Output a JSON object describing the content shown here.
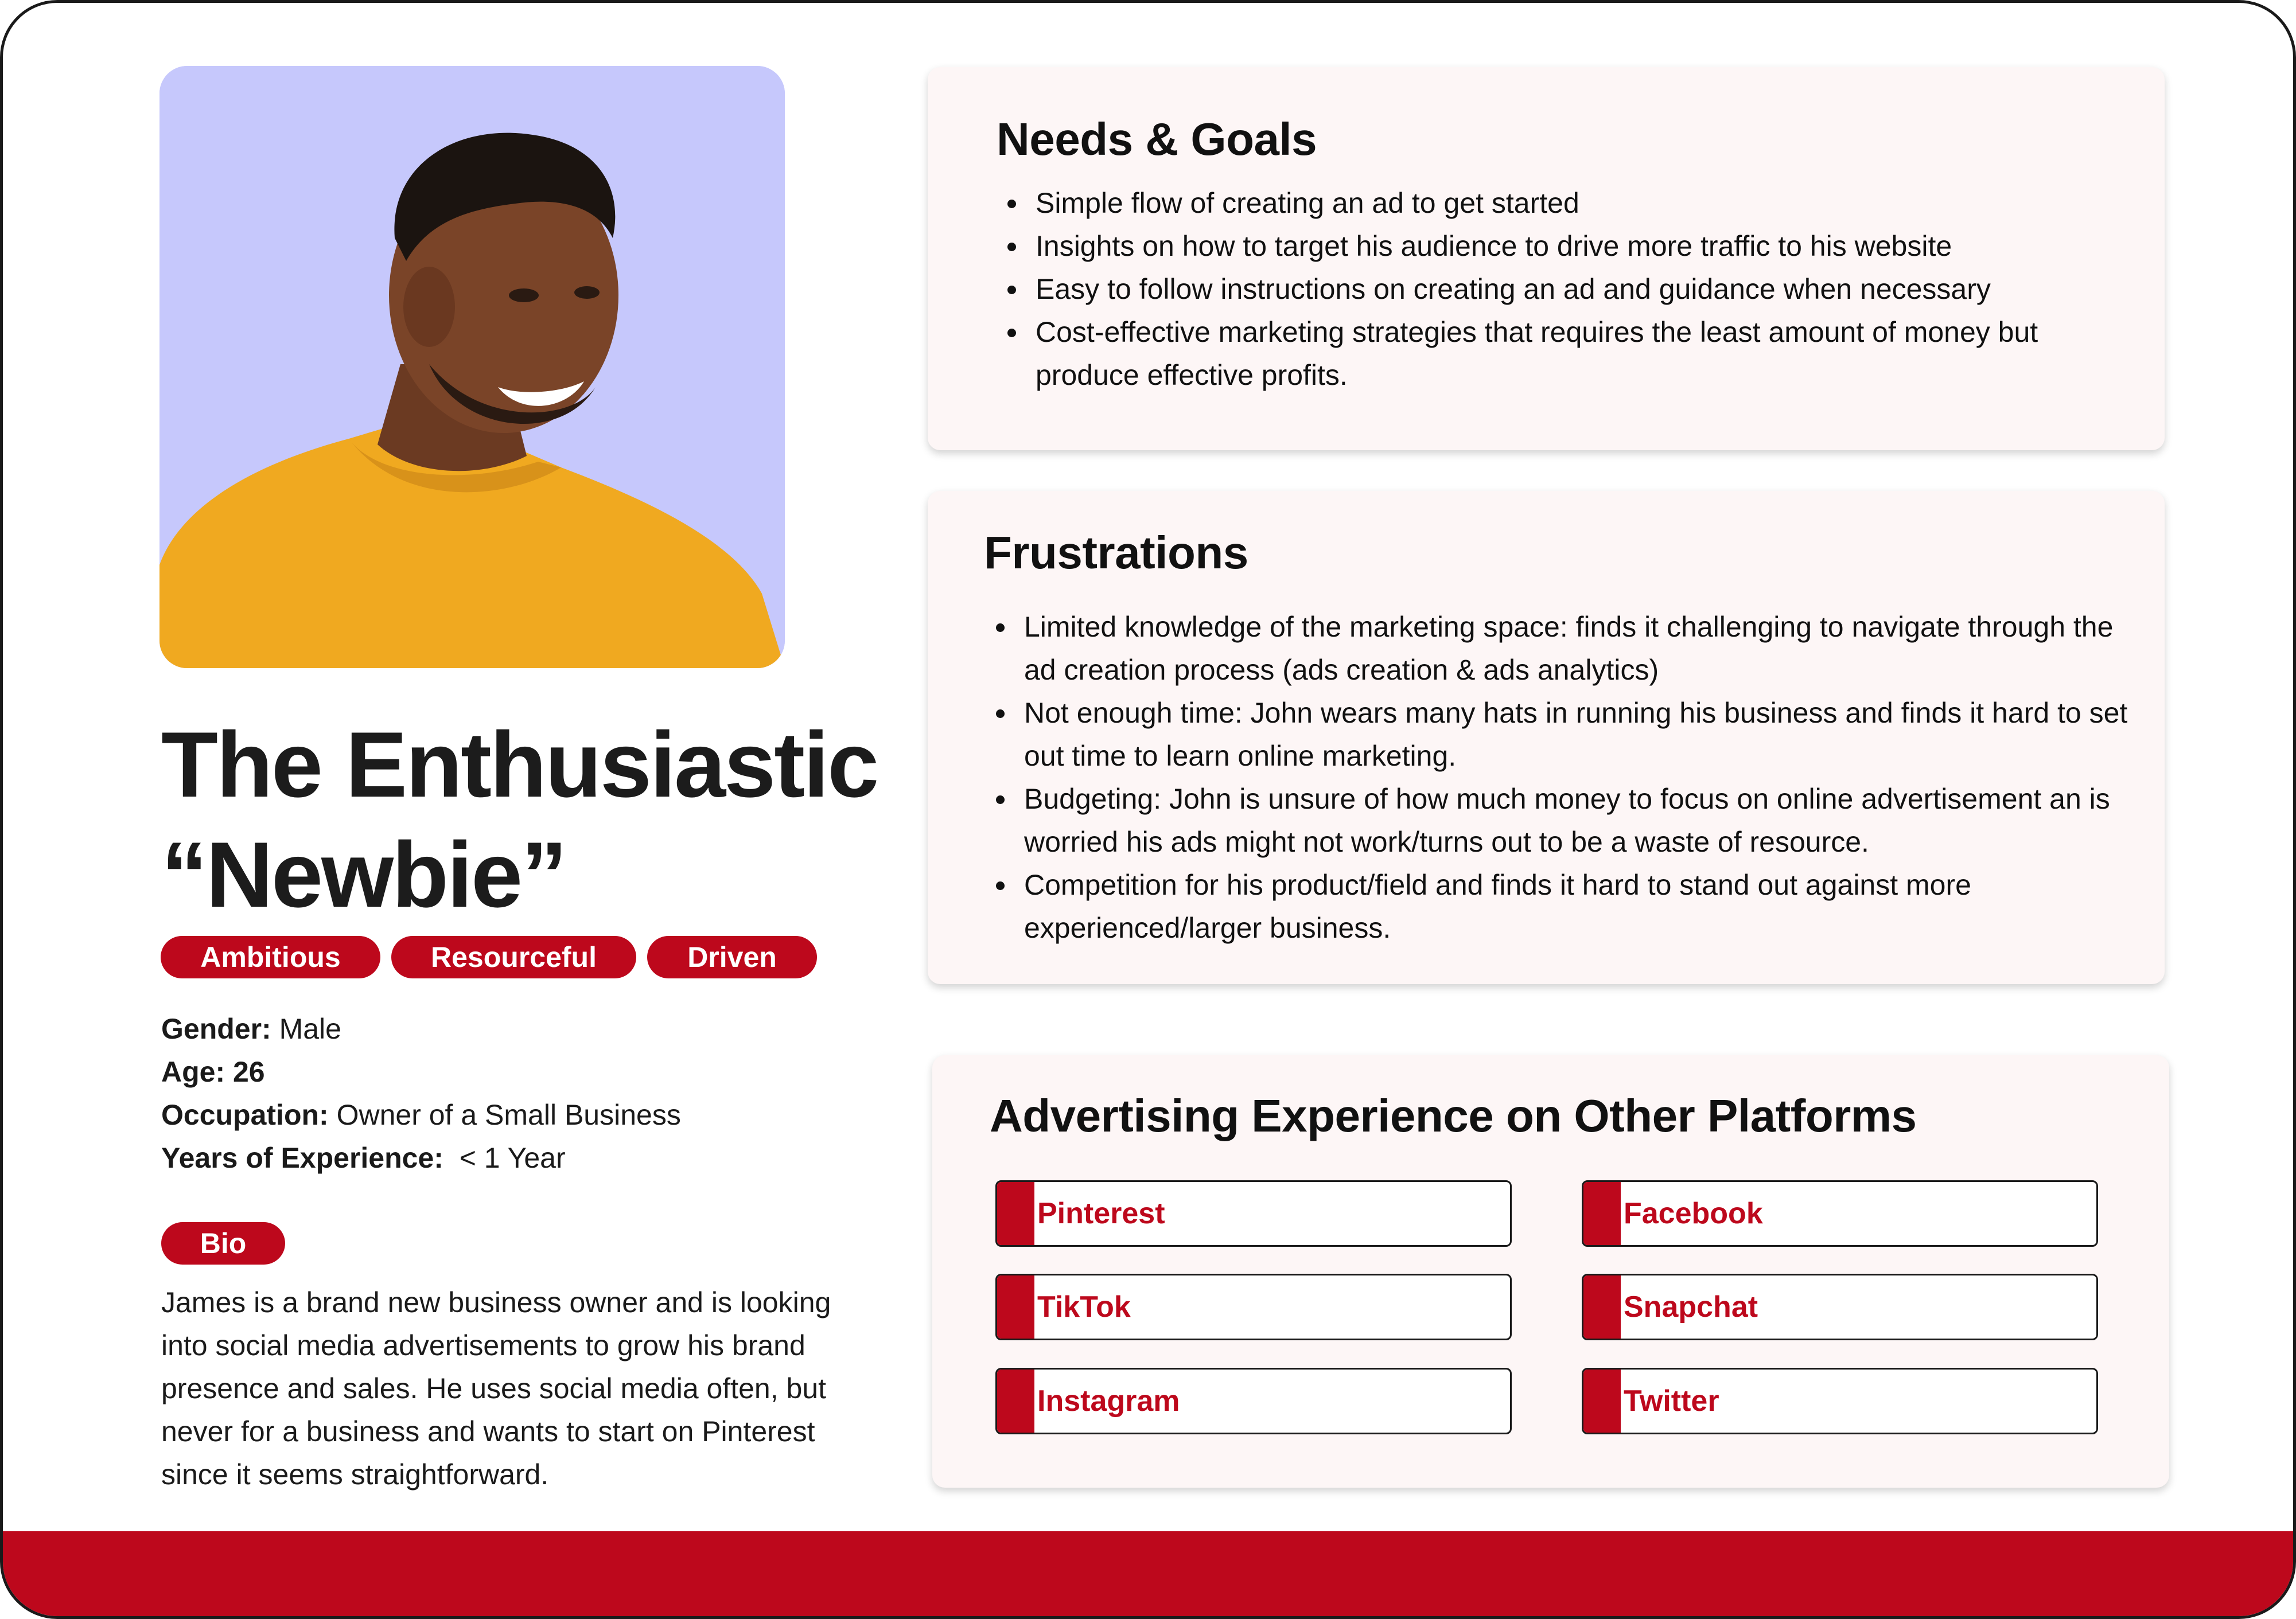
{
  "persona": {
    "title_line1": "The Enthusiastic",
    "title_line2": "“Newbie”",
    "traits": [
      "Ambitious",
      "Resourceful",
      "Driven"
    ],
    "details": [
      {
        "label": "Gender:",
        "value": " Male",
        "value_bold": false
      },
      {
        "label": "Age: 26",
        "value": "",
        "value_bold": true
      },
      {
        "label": "Occupation:",
        "value": " Owner of a Small Business",
        "value_bold": false
      },
      {
        "label": "Years of Experience:",
        "value": "  < 1 Year",
        "value_bold": false
      }
    ],
    "bio_label": "Bio",
    "bio": "James is a brand new business owner and is looking into social media advertisements to grow his brand presence and sales. He uses social media often, but never for a business and wants to start on Pinterest since it seems straightforward."
  },
  "needs_goals": {
    "heading": "Needs & Goals",
    "items": [
      "Simple flow of creating an ad to get started",
      "Insights on how to target his audience to drive more traffic to his website",
      "Easy to follow instructions on creating an ad and guidance when necessary",
      "Cost-effective marketing strategies that requires the least amount of money but produce effective profits."
    ]
  },
  "frustrations": {
    "heading": "Frustrations",
    "items": [
      "Limited knowledge of the marketing space: finds it challenging to navigate through the ad creation process (ads creation & ads analytics)",
      "Not enough time: John wears many hats in running his business and finds it hard to set out time to learn online marketing.",
      "Budgeting: John is unsure of how much money to focus on online advertisement an is worried his ads might not work/turns out to be a waste of resource.",
      "Competition for his product/field and finds it hard to stand out against more experienced/larger business."
    ]
  },
  "advertising": {
    "heading": "Advertising Experience on Other Platforms",
    "platforms": [
      "Pinterest",
      "Facebook",
      "TikTok",
      "Snapchat",
      "Instagram",
      "Twitter"
    ]
  },
  "colors": {
    "brand_red": "#bd081c",
    "photo_background": "#c6c8fc",
    "panel_background": "#fdf6f6"
  }
}
